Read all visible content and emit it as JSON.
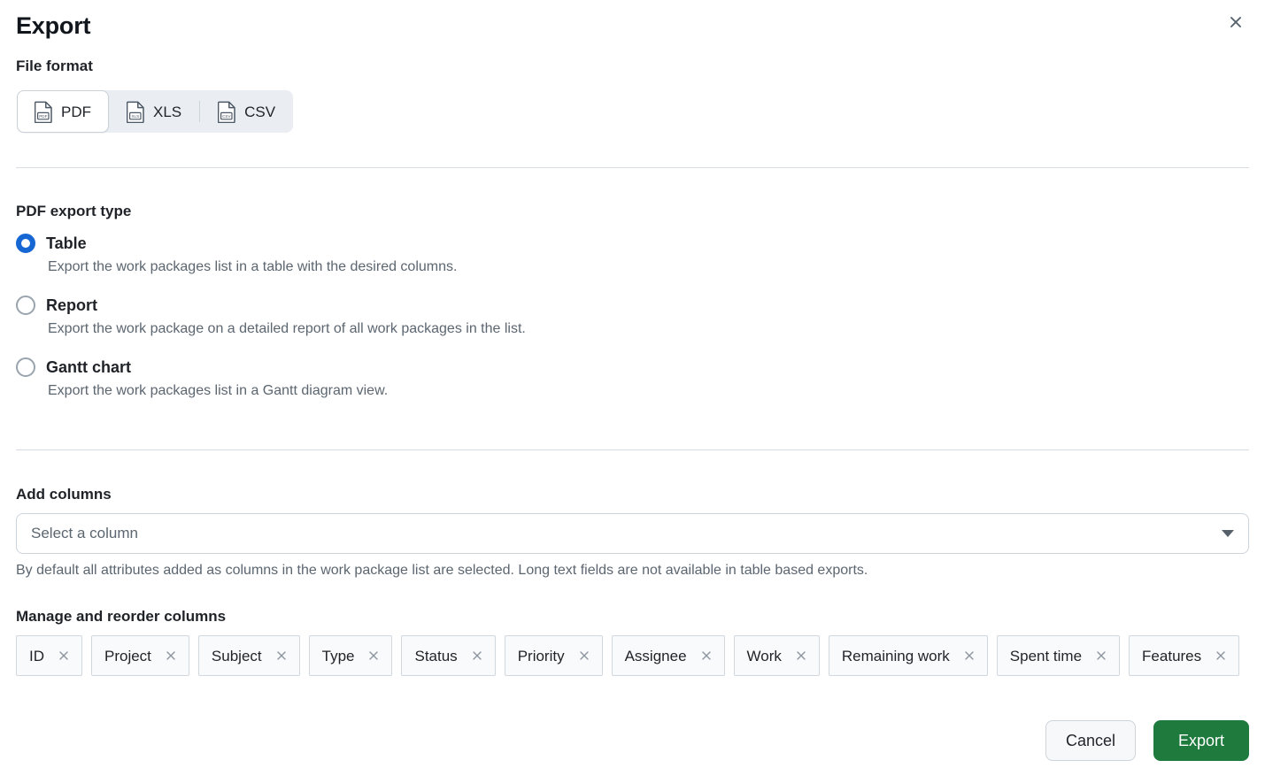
{
  "dialog": {
    "title": "Export",
    "close_icon": "close-icon"
  },
  "file_format": {
    "label": "File format",
    "selected": "PDF",
    "options": [
      {
        "id": "pdf",
        "label": "PDF",
        "icon": "pdf-file-icon",
        "icon_text": "PDF",
        "selected": true
      },
      {
        "id": "xls",
        "label": "XLS",
        "icon": "xls-file-icon",
        "icon_text": "XLS",
        "selected": false
      },
      {
        "id": "csv",
        "label": "CSV",
        "icon": "csv-file-icon",
        "icon_text": "CSV",
        "selected": false
      }
    ]
  },
  "pdf_export_type": {
    "label": "PDF export type",
    "selected": "Table",
    "options": [
      {
        "id": "table",
        "label": "Table",
        "description": "Export the work packages list in a table with the desired columns.",
        "selected": true
      },
      {
        "id": "report",
        "label": "Report",
        "description": "Export the work package on a detailed report of all work packages in the list.",
        "selected": false
      },
      {
        "id": "gantt",
        "label": "Gantt chart",
        "description": "Export the work packages list in a Gantt diagram view.",
        "selected": false
      }
    ]
  },
  "add_columns": {
    "label": "Add columns",
    "placeholder": "Select a column",
    "value": "",
    "caret_icon": "chevron-down-icon",
    "hint": "By default all attributes added as columns in the work package list are selected. Long text fields are not available in table based exports."
  },
  "manage_columns": {
    "label": "Manage and reorder columns",
    "remove_icon": "close-icon",
    "chips": [
      {
        "label": "ID"
      },
      {
        "label": "Project"
      },
      {
        "label": "Subject"
      },
      {
        "label": "Type"
      },
      {
        "label": "Status"
      },
      {
        "label": "Priority"
      },
      {
        "label": "Assignee"
      },
      {
        "label": "Work"
      },
      {
        "label": "Remaining work"
      },
      {
        "label": "Spent time"
      },
      {
        "label": "Features"
      }
    ]
  },
  "footer": {
    "cancel_label": "Cancel",
    "export_label": "Export"
  },
  "colors": {
    "accent_blue": "#1667d3",
    "export_green": "#1f7a3d",
    "border": "#ccd4dc",
    "muted_text": "#5c6670",
    "segment_bg": "#eaeef2"
  }
}
